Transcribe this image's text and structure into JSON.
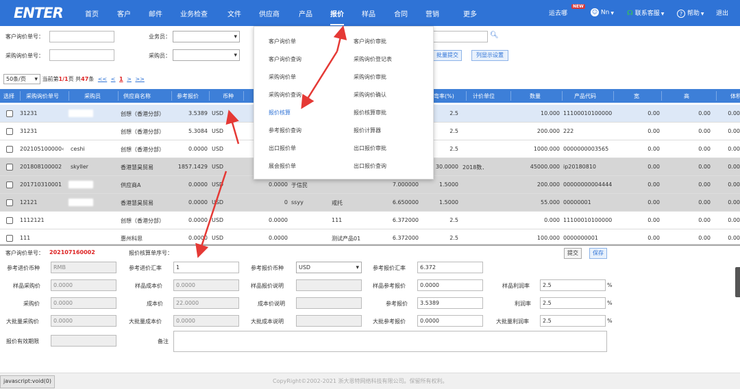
{
  "nav": {
    "logo": "ENTER",
    "items": [
      "首页",
      "客户",
      "邮件",
      "业务检查",
      "文件",
      "供应商",
      "产品",
      "报价",
      "样品",
      "合同",
      "营销",
      "更多"
    ],
    "active": "报价",
    "right": {
      "yunqu": "运去哪",
      "new_badge": "NEW",
      "user": "Nn",
      "support": "联系客服",
      "help": "帮助",
      "logout": "退出"
    }
  },
  "filters": {
    "cust_inq_no": "客户询价单号：",
    "salesman": "业务员：",
    "purch_inq_no": "采购询价单号：",
    "purchaser": "采购员：",
    "batch_submit": "批量提交",
    "col_settings": "列显示设置"
  },
  "pager": {
    "pagesize": "50条/页",
    "current_prefix": "当前第",
    "current": "1/1",
    "page_suffix": "页 共",
    "total": "47",
    "total_suffix": "条",
    "first": "<<",
    "prev": "<",
    "page": "1",
    "next": ">",
    "last": ">>"
  },
  "table": {
    "headers": [
      "选择",
      "采购询价单号",
      "采购员",
      "供应商名称",
      "参考报价",
      "币种",
      "弯率(%)",
      "计价单位",
      "数量",
      "产品代码",
      "宽",
      "高",
      "体积"
    ],
    "rows": [
      {
        "no": "31231",
        "purchaser": "",
        "supplier": "创想（香港分部）",
        "price": "3.5389",
        "cur": "USD",
        "c6": "",
        "c7": "",
        "c8": "",
        "c9": "",
        "rate": "2.5",
        "unit": "",
        "qty": "10.000",
        "code": "11100010100000",
        "w": "0.00",
        "h": "0.00"
      },
      {
        "no": "31231",
        "purchaser": "",
        "supplier": "创想（香港分部）",
        "price": "5.3084",
        "cur": "USD",
        "c6": "",
        "c7": "",
        "c8": "",
        "c9": "",
        "rate": "2.5",
        "unit": "",
        "qty": "200.000",
        "code": "222",
        "w": "0.00",
        "h": "0.00"
      },
      {
        "no": "202105100000‹",
        "purchaser": "ceshi",
        "supplier": "创想（香港分部）",
        "price": "0.0000",
        "cur": "USD",
        "c6": "",
        "c7": "",
        "c8": "",
        "c9": "",
        "rate": "2.5",
        "unit": "",
        "qty": "1000.000",
        "code": "0000000003565",
        "w": "0.00",
        "h": "0.00"
      },
      {
        "no": "201808100002",
        "purchaser": "skyller",
        "supplier": "香港慧昊贸易",
        "price": "1857.1429",
        "cur": "USD",
        "c6": "",
        "c7": "",
        "c8": "",
        "c9": "",
        "rate": "30.0000",
        "unit": "2018数．",
        "qty": "45000.000",
        "code": "ip20180810",
        "w": "0.00",
        "h": "0.00"
      },
      {
        "no": "201710310001",
        "purchaser": "",
        "supplier": "供应商A",
        "price": "0.0000",
        "cur": "USD",
        "c6": "0.0000",
        "c7": "于信民",
        "c8": "",
        "c9": "7.000000",
        "rate": "1.5000",
        "unit": "",
        "qty": "200.000",
        "code": "00000000004444",
        "w": "0.00",
        "h": "0.00"
      },
      {
        "no": "12121",
        "purchaser": "",
        "supplier": "香港慧昊贸易",
        "price": "0.0000",
        "cur": "USD",
        "c6": "0",
        "c7": "ssyy",
        "c8": "戒托",
        "c9": "6.650000",
        "rate": "1.5000",
        "unit": "",
        "qty": "55.000",
        "code": "00000001",
        "w": "0.00",
        "h": "0.00"
      },
      {
        "no": "1112121",
        "purchaser": "",
        "supplier": "创想（香港分部）",
        "price": "0.0000",
        "cur": "USD",
        "c6": "0.0000",
        "c7": "",
        "c8": "111",
        "c9": "6.372000",
        "rate": "2.5",
        "unit": "",
        "qty": "0.000",
        "code": "11100010100000",
        "w": "0.00",
        "h": "0.00"
      },
      {
        "no": "111",
        "purchaser": "",
        "supplier": "惠州科思",
        "price": "0.0000",
        "cur": "USD",
        "c6": "0.0000",
        "c7": "",
        "c8": "测试产品01",
        "c9": "6.372000",
        "rate": "2.5",
        "unit": "",
        "qty": "100.000",
        "code": "0000000001",
        "w": "0.00",
        "h": "0.00"
      }
    ]
  },
  "menu": {
    "left": [
      "客户询价单",
      "客户询价查询",
      "采购询价单",
      "采购询价查询",
      "报价核算",
      "参考报价查询",
      "出口报价单",
      "展会报价单"
    ],
    "right": [
      "客户询价审批",
      "采购询价登记表",
      "采购询价审批",
      "采购询价确认",
      "报价核算审批",
      "报价计算器",
      "出口报价审批",
      "出口报价查询"
    ],
    "highlighted": "报价核算"
  },
  "form": {
    "cust_inq_label": "客户询价单号：",
    "cust_inq_value": "202107160002",
    "seq_label": "报价核算单序号：",
    "submit": "提交",
    "save": "保存",
    "ref_in_cur_label": "参考进价币种",
    "ref_in_cur": "RMB",
    "ref_in_rate_label": "参考进价汇率",
    "ref_in_rate": "1",
    "ref_quote_cur_label": "参考报价币种",
    "ref_quote_cur": "USD",
    "ref_quote_rate_label": "参考报价汇率",
    "ref_quote_rate": "6.372",
    "sample_purch_label": "样品采购价",
    "sample_purch": "0.0000",
    "sample_cost_label": "样品成本价",
    "sample_cost": "0.0000",
    "sample_quote_note_label": "样品报价说明",
    "sample_ref_quote_label": "样品参考报价",
    "sample_ref_quote": "0.0000",
    "sample_margin_label": "样品利润率",
    "sample_margin": "2.5",
    "purch_label": "采购价",
    "purch": "0.0000",
    "cost_label": "成本价",
    "cost": "22.0000",
    "cost_note_label": "成本价说明",
    "ref_quote_label": "参考报价",
    "ref_quote": "3.5389",
    "margin_label": "利润率",
    "margin": "2.5",
    "bulk_purch_label": "大批量采购价",
    "bulk_purch": "0.0000",
    "bulk_cost_label": "大批量成本价",
    "bulk_cost": "0.0000",
    "bulk_cost_note_label": "大批成本说明",
    "bulk_ref_quote_label": "大批参考报价",
    "bulk_ref_quote": "0.0000",
    "bulk_margin_label": "大批量利润率",
    "bulk_margin": "2.5",
    "validity_label": "报价有效期限",
    "remark_label": "备注",
    "pct": "%"
  },
  "footer": {
    "copyright": "CopyRight©2002-2021 浙大恩特网络科技有限公司。保留所有权利。",
    "status": "javascript:void(0)"
  },
  "colors": {
    "nav": "#2f73d6",
    "arrow": "#e53935"
  }
}
